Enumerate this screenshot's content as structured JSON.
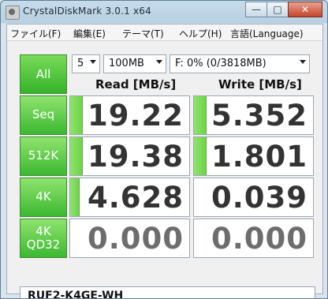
{
  "window": {
    "title": "CrystalDiskMark 3.0.1 x64",
    "controls": {
      "minimize": "—",
      "maximize": "□",
      "close": "✕"
    }
  },
  "menu": [
    "ファイル(F)",
    "編集(E)",
    "テーマ(T)",
    "ヘルプ(H)",
    "言語(Language)"
  ],
  "controls": {
    "all_label": "All",
    "count_value": "5",
    "size_value": "100MB",
    "drive_value": "F: 0% (0/3818MB)"
  },
  "columns": {
    "read": "Read [MB/s]",
    "write": "Write [MB/s]"
  },
  "rows": [
    {
      "label": "Seq",
      "read": "19.22",
      "write": "5.352",
      "read_fill": 0.1,
      "write_fill": 0.1
    },
    {
      "label": "512K",
      "read": "19.38",
      "write": "1.801",
      "read_fill": 0.1,
      "write_fill": 0.1
    },
    {
      "label": "4K",
      "read": "4.628",
      "write": "0.039",
      "read_fill": 0.07,
      "write_fill": 0.0
    },
    {
      "label": "4K\nQD32",
      "read": "0.000",
      "write": "0.000",
      "read_fill": 0.0,
      "write_fill": 0.0
    }
  ],
  "status_text": "RUF2-K4GE-WH",
  "colors": {
    "accent_green": "#6fd449",
    "button_green": "#3cb831",
    "value_text": "#333333",
    "zero_text": "#6d6d6d"
  }
}
